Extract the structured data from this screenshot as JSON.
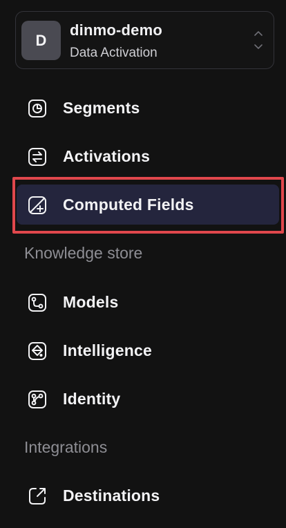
{
  "workspace": {
    "avatar_letter": "D",
    "name": "dinmo-demo",
    "subtitle": "Data Activation"
  },
  "nav": {
    "segments": {
      "label": "Segments",
      "icon": "pie-chart-icon"
    },
    "activations": {
      "label": "Activations",
      "icon": "arrows-exchange-icon"
    },
    "computed_fields": {
      "label": "Computed Fields",
      "icon": "computed-field-icon",
      "active": true
    }
  },
  "sections": {
    "knowledge_store": {
      "title": "Knowledge store",
      "items": {
        "models": {
          "label": "Models",
          "icon": "model-graph-icon"
        },
        "intelligence": {
          "label": "Intelligence",
          "icon": "intelligence-icon"
        },
        "identity": {
          "label": "Identity",
          "icon": "identity-graph-icon"
        }
      }
    },
    "integrations": {
      "title": "Integrations",
      "items": {
        "destinations": {
          "label": "Destinations",
          "icon": "external-link-icon"
        }
      }
    }
  },
  "colors": {
    "background": "#121212",
    "active_item": "#24253d",
    "highlight_border": "#e0474c",
    "section_text": "#8e8e94"
  }
}
